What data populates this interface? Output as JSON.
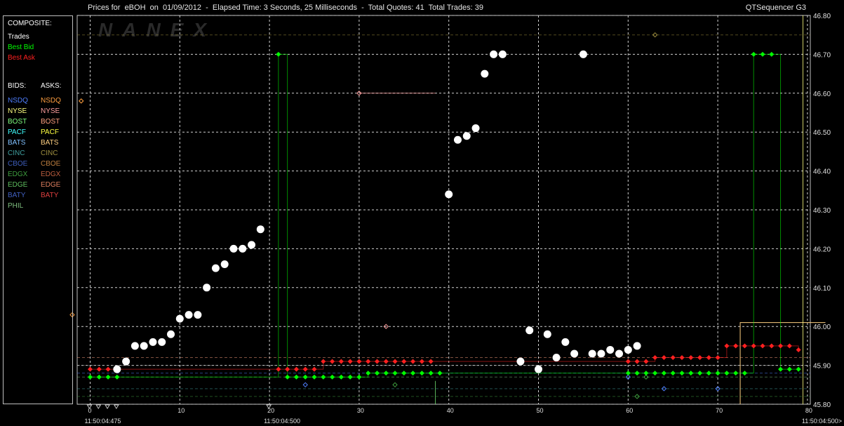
{
  "header": {
    "title": "Prices for  eBOH  on  01/09/2012  -  Elapsed Time: 3 Seconds, 25 Milliseconds  -  Total Quotes: 41  Total Trades: 39",
    "product": "QTSequencer G3",
    "watermark": "NANEX"
  },
  "legend": {
    "composite_title": "COMPOSITE:",
    "composite": [
      {
        "label": "Trades",
        "color": "#ffffff"
      },
      {
        "label": "Best Bid",
        "color": "#00ff00"
      },
      {
        "label": "Best Ask",
        "color": "#ff2020"
      }
    ],
    "bids_title": "BIDS:",
    "asks_title": "ASKS:",
    "bids": [
      {
        "label": "NSDQ",
        "color": "#4f7fff"
      },
      {
        "label": "NYSE",
        "color": "#ffff80"
      },
      {
        "label": "BOST",
        "color": "#80ff80"
      },
      {
        "label": "PACF",
        "color": "#40ffff"
      },
      {
        "label": "BATS",
        "color": "#80c0ff"
      },
      {
        "label": "CINC",
        "color": "#3f9f9f"
      },
      {
        "label": "CBOE",
        "color": "#3f5fbf"
      },
      {
        "label": "EDGX",
        "color": "#3f9f3f"
      },
      {
        "label": "EDGE",
        "color": "#5fbf5f"
      },
      {
        "label": "BATY",
        "color": "#4060c0"
      },
      {
        "label": "PHIL",
        "color": "#7fbf7f"
      }
    ],
    "asks": [
      {
        "label": "NSDQ",
        "color": "#ff9f40"
      },
      {
        "label": "NYSE",
        "color": "#ff9f9f"
      },
      {
        "label": "BOST",
        "color": "#ff9f7f"
      },
      {
        "label": "PACF",
        "color": "#ffff40"
      },
      {
        "label": "BATS",
        "color": "#ffcf80"
      },
      {
        "label": "CINC",
        "color": "#9f8f3f"
      },
      {
        "label": "CBOE",
        "color": "#bf7f3f"
      },
      {
        "label": "EDGX",
        "color": "#bf5f3f"
      },
      {
        "label": "EDGE",
        "color": "#df7f5f"
      },
      {
        "label": "BATY",
        "color": "#df3f3f"
      }
    ]
  },
  "chart_data": {
    "type": "scatter",
    "title": "Prices for  eBOH  on  01/09/2012",
    "xlabel": "",
    "ylabel": "",
    "xlim": [
      -2,
      82
    ],
    "ylim": [
      45.8,
      46.8
    ],
    "xticks": [
      0,
      10,
      20,
      30,
      40,
      50,
      60,
      70,
      80
    ],
    "yticks": [
      45.8,
      45.9,
      46.0,
      46.1,
      46.2,
      46.3,
      46.4,
      46.5,
      46.6,
      46.7,
      46.8
    ],
    "time_labels": [
      {
        "x": 0,
        "label": "11:50:04:475"
      },
      {
        "x": 20,
        "label": "11:50:04:500"
      },
      {
        "x": 80,
        "label": "11:50:04:500>"
      }
    ],
    "grid": true,
    "series": [
      {
        "name": "Trades",
        "color": "#ffffff",
        "marker": "dot",
        "x": [
          3,
          4,
          5,
          6,
          7,
          8,
          9,
          10,
          11,
          12,
          13,
          14,
          15,
          16,
          17,
          18,
          19,
          40,
          41,
          42,
          43,
          44,
          45,
          46,
          48,
          49,
          50,
          51,
          52,
          53,
          54,
          55,
          56,
          57,
          58,
          59,
          60,
          61
        ],
        "values": [
          45.89,
          45.91,
          45.95,
          45.95,
          45.96,
          45.96,
          45.98,
          46.02,
          46.03,
          46.03,
          46.1,
          46.15,
          46.16,
          46.2,
          46.2,
          46.21,
          46.25,
          46.34,
          46.48,
          46.49,
          46.51,
          46.65,
          46.7,
          46.7,
          45.91,
          45.99,
          45.89,
          45.98,
          45.92,
          45.96,
          45.93,
          46.7,
          45.93,
          45.93,
          45.94,
          45.93,
          45.94,
          45.95
        ]
      },
      {
        "name": "Best Bid",
        "color": "#00ff00",
        "marker": "diamond",
        "x": [
          0,
          1,
          2,
          3,
          21,
          22,
          23,
          24,
          25,
          26,
          27,
          28,
          29,
          30,
          31,
          32,
          33,
          34,
          35,
          36,
          37,
          38,
          39,
          60,
          61,
          62,
          63,
          64,
          65,
          66,
          67,
          68,
          69,
          70,
          71,
          72,
          73,
          74,
          75,
          76,
          77,
          78,
          79
        ],
        "values": [
          45.87,
          45.87,
          45.87,
          45.87,
          46.7,
          45.87,
          45.87,
          45.87,
          45.87,
          45.87,
          45.87,
          45.87,
          45.87,
          45.87,
          45.88,
          45.88,
          45.88,
          45.88,
          45.88,
          45.88,
          45.88,
          45.88,
          45.88,
          45.88,
          45.88,
          45.88,
          45.88,
          45.88,
          45.88,
          45.88,
          45.88,
          45.88,
          45.88,
          45.88,
          45.88,
          45.88,
          45.88,
          46.7,
          46.7,
          46.7,
          45.89,
          45.89,
          45.89
        ]
      },
      {
        "name": "Best Ask",
        "color": "#ff2020",
        "marker": "diamond",
        "x": [
          0,
          1,
          2,
          21,
          22,
          23,
          24,
          25,
          26,
          27,
          28,
          29,
          30,
          31,
          32,
          33,
          34,
          35,
          36,
          37,
          38,
          60,
          61,
          62,
          63,
          64,
          65,
          66,
          67,
          68,
          69,
          70,
          71,
          72,
          73,
          74,
          75,
          76,
          77,
          78,
          79
        ],
        "values": [
          45.89,
          45.89,
          45.89,
          45.89,
          45.89,
          45.89,
          45.89,
          45.89,
          45.91,
          45.91,
          45.91,
          45.91,
          45.91,
          45.91,
          45.91,
          45.91,
          45.91,
          45.91,
          45.91,
          45.91,
          45.91,
          45.91,
          45.91,
          45.91,
          45.92,
          45.92,
          45.92,
          45.92,
          45.92,
          45.92,
          45.92,
          45.92,
          45.95,
          45.95,
          45.95,
          45.95,
          45.95,
          45.95,
          45.95,
          45.95,
          45.94
        ]
      }
    ],
    "quote_markers": [
      {
        "name": "NSDQ ask",
        "color": "#ff9f40",
        "x": [
          -2,
          -1
        ],
        "values": [
          46.03,
          46.58
        ]
      },
      {
        "name": "NYSE ask",
        "color": "#ff9f9f",
        "x": [
          30,
          33
        ],
        "values": [
          46.6,
          46.0
        ]
      },
      {
        "name": "NSDQ bid",
        "color": "#4f7fff",
        "x": [
          24,
          60,
          64,
          70
        ],
        "values": [
          45.85,
          45.87,
          45.84,
          45.84
        ]
      },
      {
        "name": "EDGX bid",
        "color": "#3f9f3f",
        "x": [
          34,
          61,
          62
        ],
        "values": [
          45.85,
          45.82,
          45.87
        ]
      },
      {
        "name": "EDGE ask",
        "color": "#9f8f3f",
        "x": [
          63
        ],
        "values": [
          46.75
        ]
      }
    ]
  }
}
